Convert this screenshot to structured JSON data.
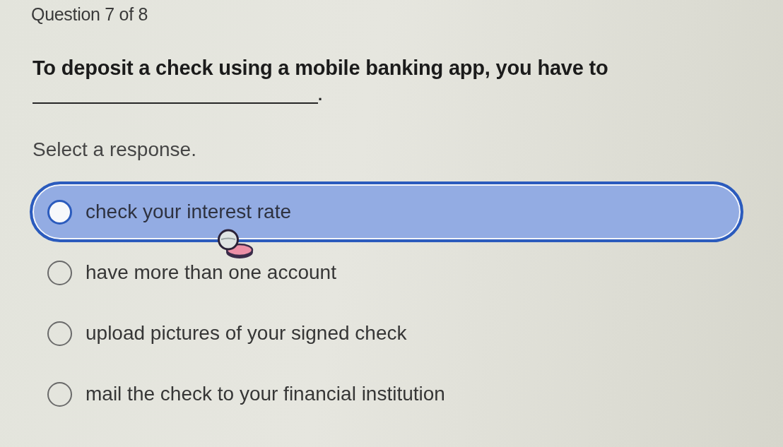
{
  "header": {
    "question_number": "Question 7 of 8"
  },
  "question": {
    "text": "To deposit a check using a mobile banking app, you have to",
    "after_blank": "."
  },
  "instruction": "Select a response.",
  "options": [
    {
      "label": "check your interest rate",
      "selected": false,
      "highlighted": true
    },
    {
      "label": "have more than one account",
      "selected": false,
      "highlighted": false
    },
    {
      "label": "upload pictures of your signed check",
      "selected": false,
      "highlighted": false
    },
    {
      "label": "mail the check to your financial institution",
      "selected": false,
      "highlighted": false
    }
  ]
}
